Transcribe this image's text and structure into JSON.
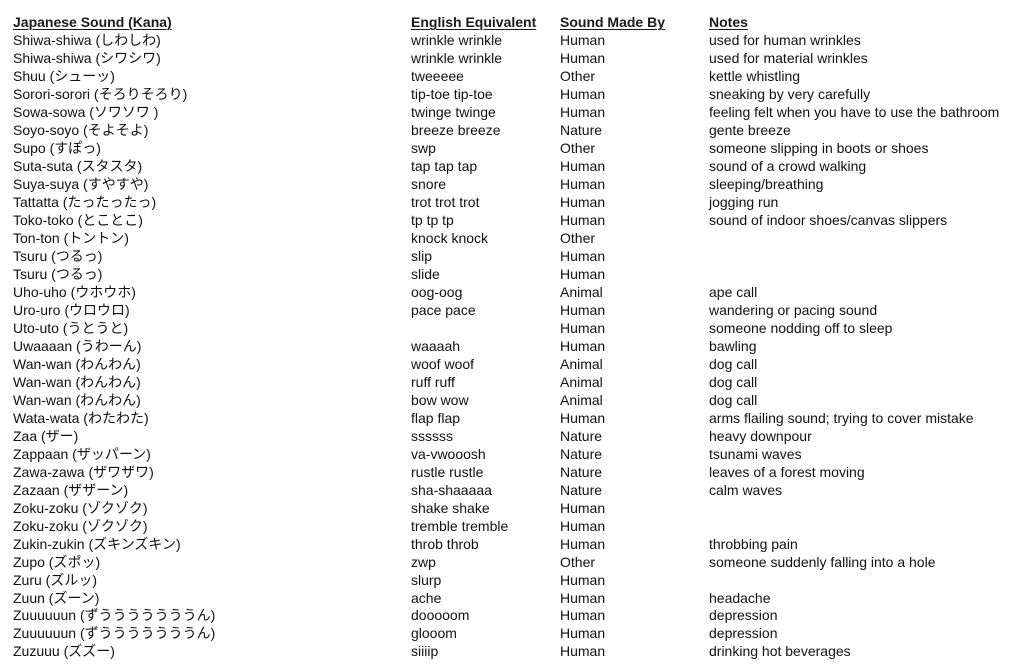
{
  "table": {
    "headers": [
      "Japanese Sound (Kana)",
      "English Equivalent",
      "Sound Made By",
      "Notes"
    ],
    "rows": [
      {
        "japanese": "Shiwa-shiwa (しわしわ)",
        "english": "wrinkle wrinkle",
        "made_by": "Human",
        "notes": "used for human wrinkles"
      },
      {
        "japanese": "Shiwa-shiwa (シワシワ)",
        "english": "wrinkle wrinkle",
        "made_by": "Human",
        "notes": "used for material wrinkles"
      },
      {
        "japanese": "Shuu (シューッ)",
        "english": "tweeeee",
        "made_by": "Other",
        "notes": "kettle whistling"
      },
      {
        "japanese": "Sorori-sorori (そろりそろり)",
        "english": "tip-toe   tip-toe",
        "made_by": "Human",
        "notes": "sneaking by very carefully"
      },
      {
        "japanese": "Sowa-sowa (ソワソワ )",
        "english": "twinge twinge",
        "made_by": "Human",
        "notes": "feeling felt when you have to use the bathroom"
      },
      {
        "japanese": "Soyo-soyo (そよそよ)",
        "english": "breeze breeze",
        "made_by": "Nature",
        "notes": "gente breeze"
      },
      {
        "japanese": "Supo (すぽっ)",
        "english": "swp",
        "made_by": "Other",
        "notes": "someone slipping in boots or shoes"
      },
      {
        "japanese": "Suta-suta (スタスタ)",
        "english": "tap tap tap",
        "made_by": "Human",
        "notes": "sound of a crowd walking"
      },
      {
        "japanese": "Suya-suya (すやすや)",
        "english": "snore",
        "made_by": "Human",
        "notes": "sleeping/breathing"
      },
      {
        "japanese": "Tattatta (たったったっ)",
        "english": "trot trot trot",
        "made_by": "Human",
        "notes": "jogging run"
      },
      {
        "japanese": "Toko-toko (とことこ)",
        "english": "tp tp tp",
        "made_by": "Human",
        "notes": "sound of indoor shoes/canvas slippers"
      },
      {
        "japanese": "Ton-ton (トントン)",
        "english": "knock knock",
        "made_by": "Other",
        "notes": ""
      },
      {
        "japanese": "Tsuru (つるっ)",
        "english": "slip",
        "made_by": "Human",
        "notes": ""
      },
      {
        "japanese": "Tsuru (つるっ)",
        "english": "slide",
        "made_by": "Human",
        "notes": ""
      },
      {
        "japanese": "Uho-uho (ウホウホ)",
        "english": "oog-oog",
        "made_by": "Animal",
        "notes": "ape call"
      },
      {
        "japanese": "Uro-uro (ウロウロ)",
        "english": "pace pace",
        "made_by": "Human",
        "notes": "wandering or pacing sound"
      },
      {
        "japanese": "Uto-uto (うとうと)",
        "english": "",
        "made_by": "Human",
        "notes": "someone nodding off to sleep"
      },
      {
        "japanese": "Uwaaaan (うわーん)",
        "english": "waaaah",
        "made_by": "Human",
        "notes": "bawling"
      },
      {
        "japanese": "Wan-wan (わんわん)",
        "english": "woof woof",
        "made_by": "Animal",
        "notes": "dog call"
      },
      {
        "japanese": "Wan-wan (わんわん)",
        "english": "ruff ruff",
        "made_by": "Animal",
        "notes": "dog call"
      },
      {
        "japanese": "Wan-wan (わんわん)",
        "english": "bow wow",
        "made_by": "Animal",
        "notes": "dog call"
      },
      {
        "japanese": "Wata-wata (わたわた)",
        "english": "flap flap",
        "made_by": "Human",
        "notes": "arms flailing sound; trying to cover mistake"
      },
      {
        "japanese": "Zaa (ザー)",
        "english": "ssssss",
        "made_by": "Nature",
        "notes": "heavy downpour"
      },
      {
        "japanese": "Zappaan (ザッパーン)",
        "english": "va-vwooosh",
        "made_by": "Nature",
        "notes": "tsunami waves"
      },
      {
        "japanese": "Zawa-zawa (ザワザワ)",
        "english": "rustle rustle",
        "made_by": "Nature",
        "notes": "leaves of a forest moving"
      },
      {
        "japanese": "Zazaan (ザザーン)",
        "english": "sha-shaaaaa",
        "made_by": "Nature",
        "notes": "calm waves"
      },
      {
        "japanese": "Zoku-zoku (ゾクゾク)",
        "english": "shake shake",
        "made_by": "Human",
        "notes": ""
      },
      {
        "japanese": "Zoku-zoku (ゾクゾク)",
        "english": "tremble tremble",
        "made_by": "Human",
        "notes": ""
      },
      {
        "japanese": "Zukin-zukin (ズキンズキン)",
        "english": "throb throb",
        "made_by": "Human",
        "notes": "throbbing pain"
      },
      {
        "japanese": "Zupo (ズポッ)",
        "english": "zwp",
        "made_by": "Other",
        "notes": "someone suddenly falling into a hole"
      },
      {
        "japanese": "Zuru (ズルッ)",
        "english": "slurp",
        "made_by": "Human",
        "notes": ""
      },
      {
        "japanese": "Zuun (ズーン)",
        "english": "ache",
        "made_by": "Human",
        "notes": "headache"
      },
      {
        "japanese": "Zuuuuuun (ずうううううううん)",
        "english": "dooooom",
        "made_by": "Human",
        "notes": "depression"
      },
      {
        "japanese": "Zuuuuuun (ずうううううううん)",
        "english": "glooom",
        "made_by": "Human",
        "notes": "depression"
      },
      {
        "japanese": "Zuzuuu (ズズー)",
        "english": "siiiip",
        "made_by": "Human",
        "notes": "drinking hot beverages"
      }
    ]
  }
}
